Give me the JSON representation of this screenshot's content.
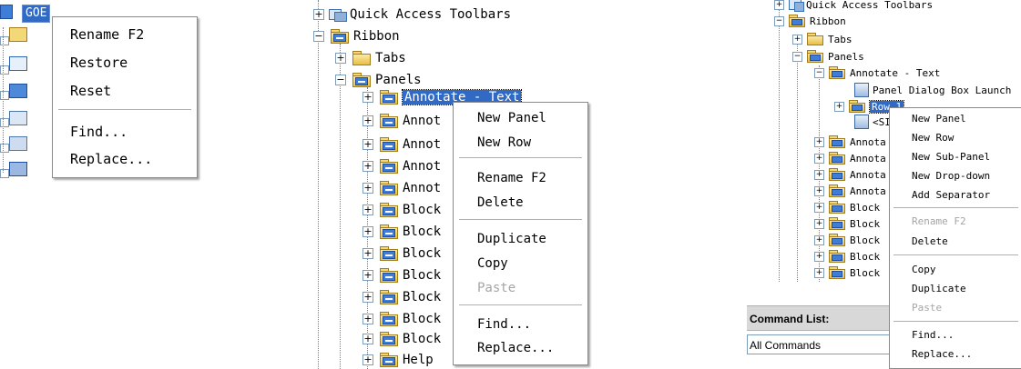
{
  "panel1": {
    "selected_node_label": "GOE",
    "context_menu": {
      "items": [
        {
          "label": "Rename  F2",
          "disabled": false
        },
        {
          "label": "Restore",
          "disabled": false
        },
        {
          "label": "Reset",
          "disabled": false
        },
        {
          "label": "Find...",
          "disabled": false
        },
        {
          "label": "Replace...",
          "disabled": false
        }
      ]
    }
  },
  "panel2": {
    "tree": {
      "quick_access": "Quick Access Toolbars",
      "ribbon": "Ribbon",
      "tabs": "Tabs",
      "panels": "Panels",
      "children": [
        "Annotate - Text",
        "Annot",
        "Annot",
        "Annot",
        "Annot",
        "Block",
        "Block",
        "Block",
        "Block",
        "Block",
        "Block",
        "Block",
        "Help"
      ]
    },
    "context_menu": {
      "items": [
        {
          "label": "New Panel",
          "disabled": false
        },
        {
          "label": "New Row",
          "disabled": false
        },
        {
          "label": "Rename  F2",
          "disabled": false
        },
        {
          "label": "Delete",
          "disabled": false
        },
        {
          "label": "Duplicate",
          "disabled": false
        },
        {
          "label": "Copy",
          "disabled": false
        },
        {
          "label": "Paste",
          "disabled": true
        },
        {
          "label": "Find...",
          "disabled": false
        },
        {
          "label": "Replace...",
          "disabled": false
        }
      ]
    }
  },
  "panel3": {
    "tree": {
      "quick_access": "Quick Access Toolbars",
      "ribbon": "Ribbon",
      "tabs": "Tabs",
      "panels": "Panels",
      "annotate_text": "Annotate - Text",
      "dialog_launcher": "Panel Dialog Box Launch",
      "row": "Row 1",
      "slideout": "<SI",
      "children": [
        "Annota",
        "Annota",
        "Annota",
        "Annota",
        "Block",
        "Block",
        "Block",
        "Block",
        "Block"
      ]
    },
    "context_menu": {
      "items": [
        {
          "label": "New Panel",
          "disabled": false
        },
        {
          "label": "New Row",
          "disabled": false
        },
        {
          "label": "New Sub-Panel",
          "disabled": false
        },
        {
          "label": "New Drop-down",
          "disabled": false
        },
        {
          "label": "Add Separator",
          "disabled": false
        },
        {
          "label": "Rename  F2",
          "disabled": true
        },
        {
          "label": "Delete",
          "disabled": false
        },
        {
          "label": "Copy",
          "disabled": false
        },
        {
          "label": "Duplicate",
          "disabled": false
        },
        {
          "label": "Paste",
          "disabled": true
        },
        {
          "label": "Find...",
          "disabled": false
        },
        {
          "label": "Replace...",
          "disabled": false
        }
      ]
    },
    "command_list_label": "Command List:",
    "command_filter_value": "All Commands"
  },
  "colors": {
    "selection": "#316ac5",
    "disabled_text": "#a5a5a5",
    "menu_border": "#8a8a8a",
    "command_bar": "#d8d8d8"
  }
}
